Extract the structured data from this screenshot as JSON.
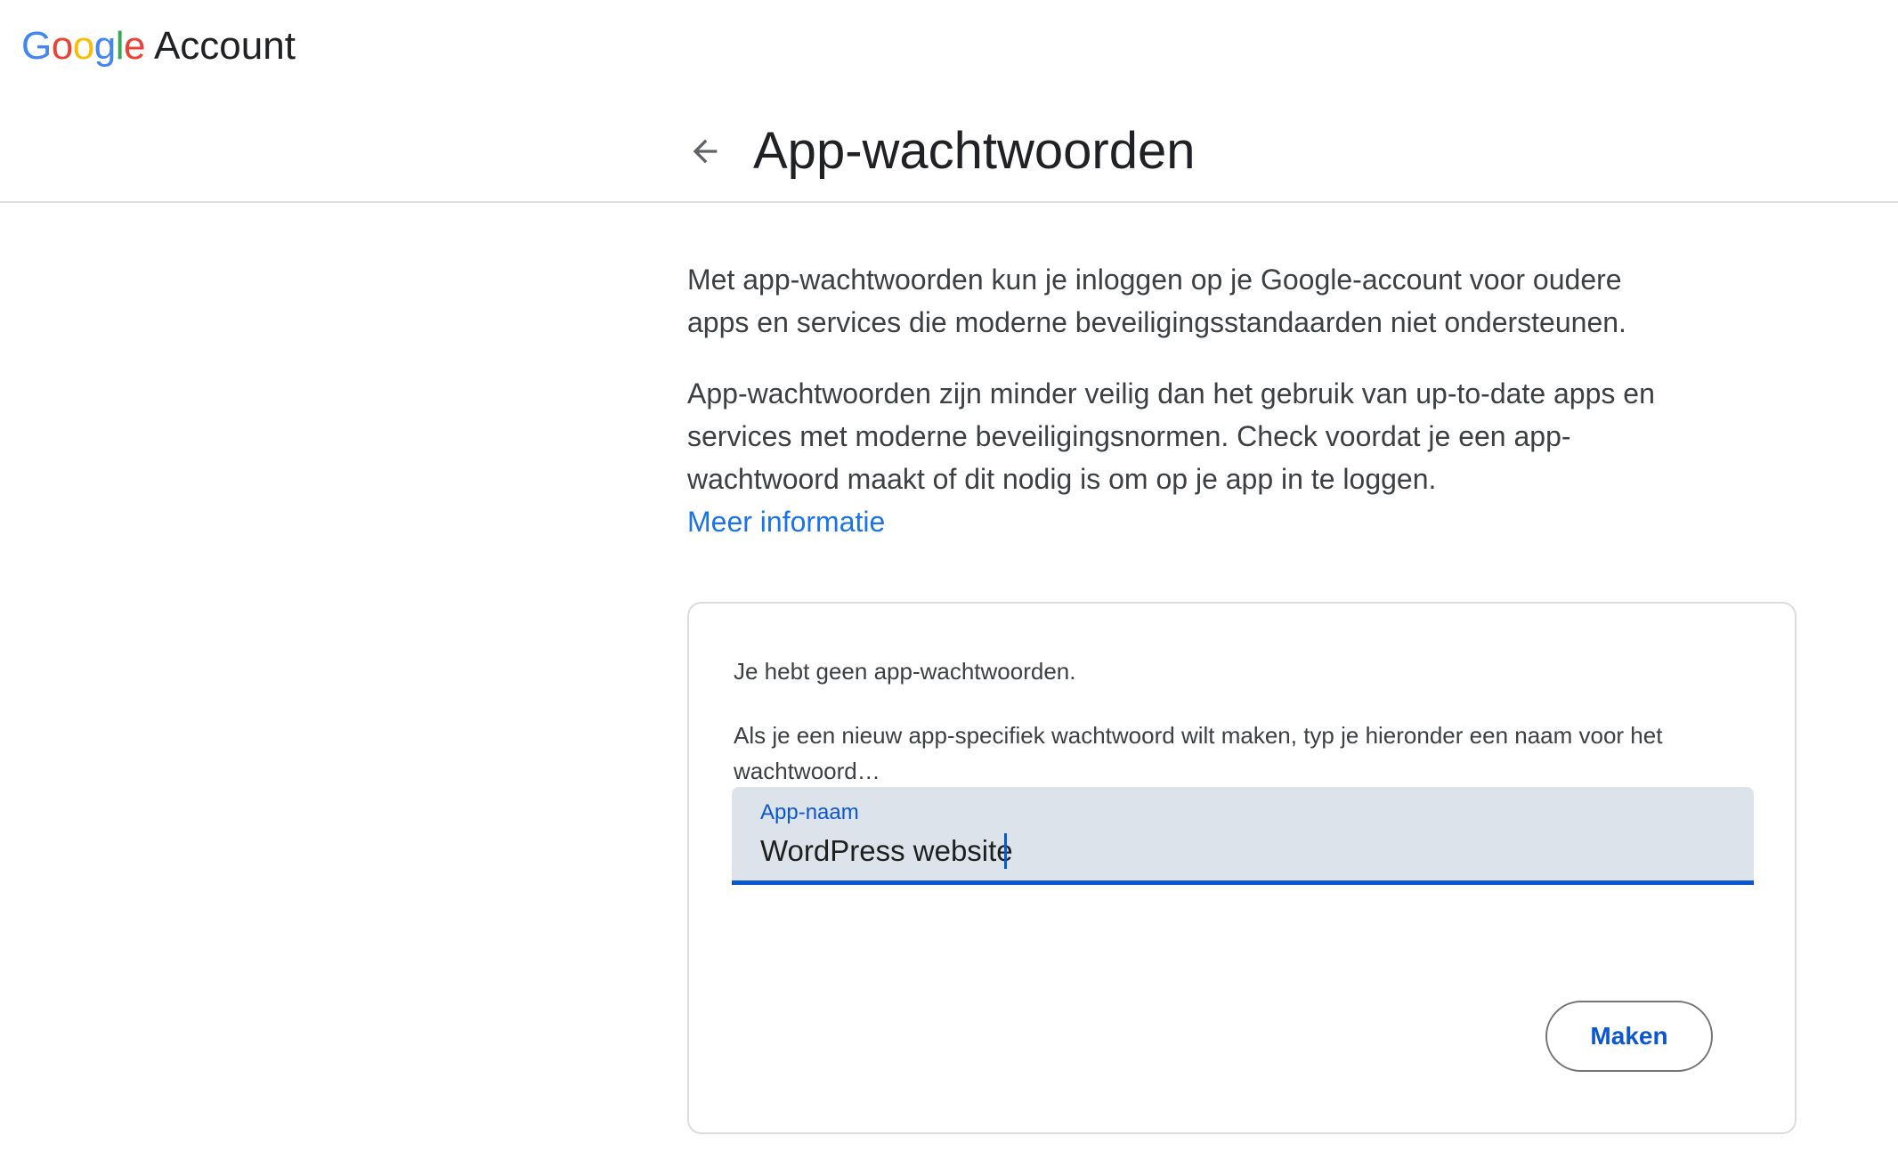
{
  "logo": {
    "letters": [
      "G",
      "o",
      "o",
      "g",
      "l",
      "e"
    ],
    "product": "Account"
  },
  "header": {
    "back_icon": "arrow-back-icon",
    "title": "App-wachtwoorden"
  },
  "intro": {
    "paragraph1": "Met app-wachtwoorden kun je inloggen op je Google-account voor oudere apps en services die moderne beveiligingsstandaarden niet ondersteunen.",
    "paragraph2": "App-wachtwoorden zijn minder veilig dan het gebruik van up-to-date apps en services met moderne beveiligingsnormen. Check voordat je een app-wachtwoord maakt of dit nodig is om op je app in te loggen.",
    "learn_more": "Meer informatie"
  },
  "card": {
    "no_passwords": "Je hebt geen app-wachtwoorden.",
    "instruction": "Als je een nieuw app-specifiek wachtwoord wilt maken, typ je hieronder een naam voor het wachtwoord…",
    "field_label": "App-naam",
    "field_value": "WordPress website",
    "create_button": "Maken"
  },
  "colors": {
    "google_blue": "#4285f4",
    "google_red": "#ea4335",
    "google_yellow": "#fbbc05",
    "google_green": "#34a853",
    "accent": "#0b57d0",
    "link": "#1a73e8",
    "field_bg": "#dde3ea"
  }
}
